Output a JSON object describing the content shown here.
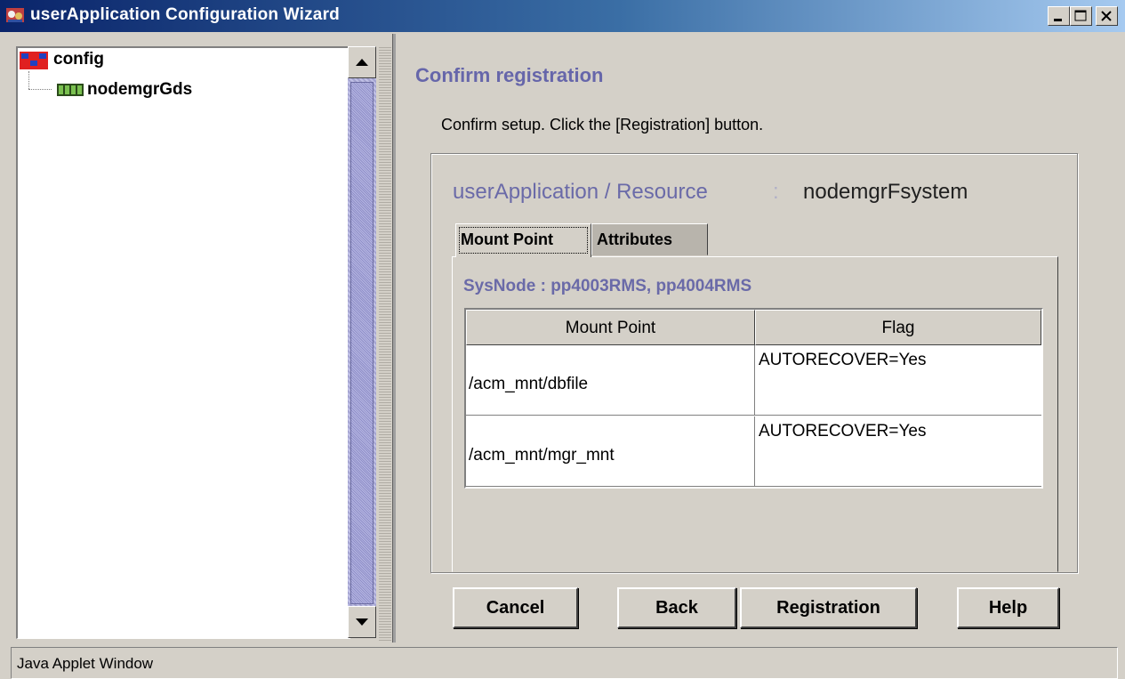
{
  "window": {
    "title": "userApplication Configuration Wizard",
    "controls": [
      "minimize-icon",
      "maximize-icon",
      "close-icon"
    ]
  },
  "tree": {
    "root": {
      "label": "config",
      "icon": "config-icon"
    },
    "children": [
      {
        "label": "nodemgrGds",
        "icon": "gds-icon"
      }
    ]
  },
  "main": {
    "heading": "Confirm registration",
    "instruction": "Confirm setup.  Click the [Registration] button.",
    "resource": {
      "label": "userApplication / Resource",
      "separator": ":",
      "value": "nodemgrFsystem"
    },
    "tabs": [
      {
        "label": "Mount Point",
        "selected": true
      },
      {
        "label": "Attributes",
        "selected": false
      }
    ],
    "sysnode": "SysNode : pp4003RMS, pp4004RMS",
    "table": {
      "headers": [
        "Mount Point",
        "Flag"
      ],
      "rows": [
        [
          "/acm_mnt/dbfile",
          "AUTORECOVER=Yes"
        ],
        [
          "/acm_mnt/mgr_mnt",
          "AUTORECOVER=Yes"
        ]
      ]
    }
  },
  "buttons": {
    "cancel": "Cancel",
    "back": "Back",
    "registration": "Registration",
    "help": "Help"
  },
  "status": "Java Applet Window",
  "colors": {
    "titlebar_start": "#0a246a",
    "titlebar_end": "#a6caf0",
    "heading": "#6666aa",
    "face": "#d4d0c8"
  }
}
